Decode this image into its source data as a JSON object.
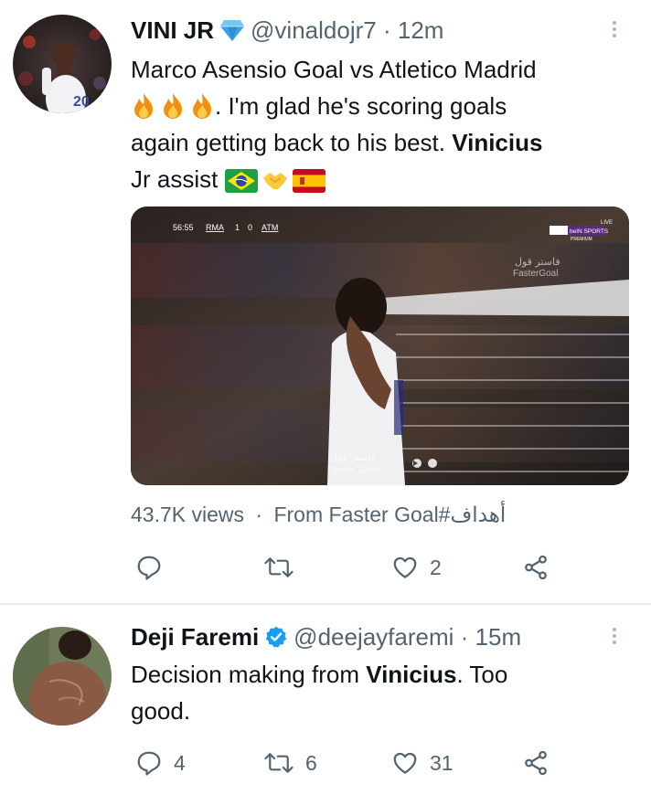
{
  "tweets": [
    {
      "name": "VINI JR",
      "handle": "@vinaldojr7",
      "dot": "·",
      "time": "12m",
      "text_line1": "Marco Asensio Goal vs Atletico Madrid",
      "text_line2": ". I'm glad he's scoring goals",
      "text_line3_a": "again getting back to his best. ",
      "text_line3_b": "Vinicius",
      "text_line4": "Jr assist",
      "media": {
        "clock": "56:55",
        "home": "RMA",
        "score_home": "1",
        "score_away": "0",
        "away": "ATM",
        "network": "beIN SPORTS",
        "network_sub": "PREMIUM",
        "live": "LIVE",
        "watermark_ar": "فاستر قول",
        "watermark_en": "FasterGoal",
        "bottom_ar": "فاستر قول",
        "bottom_en": "Faster Goal"
      },
      "views": "43.7K views",
      "meta_dot": "·",
      "source": "From Faster Goal#أهداف",
      "likes": "2",
      "icons": [
        "reply-icon",
        "retweet-icon",
        "like-icon",
        "share-icon"
      ]
    },
    {
      "name": "Deji Faremi",
      "handle": "@deejayfaremi",
      "dot": "·",
      "time": "15m",
      "text_a": "Decision making from ",
      "text_b": "Vinicius",
      "text_c": ". Too",
      "text_line2": "good.",
      "replies": "4",
      "retweets": "6",
      "likes": "31",
      "icons": [
        "reply-icon",
        "retweet-icon",
        "like-icon",
        "share-icon"
      ]
    }
  ],
  "colors": {
    "text": "#0f1419",
    "secondary": "#536471",
    "verified": "#1d9bf0",
    "diamond": "#3aa0e8",
    "divider": "#e6ecf0"
  }
}
